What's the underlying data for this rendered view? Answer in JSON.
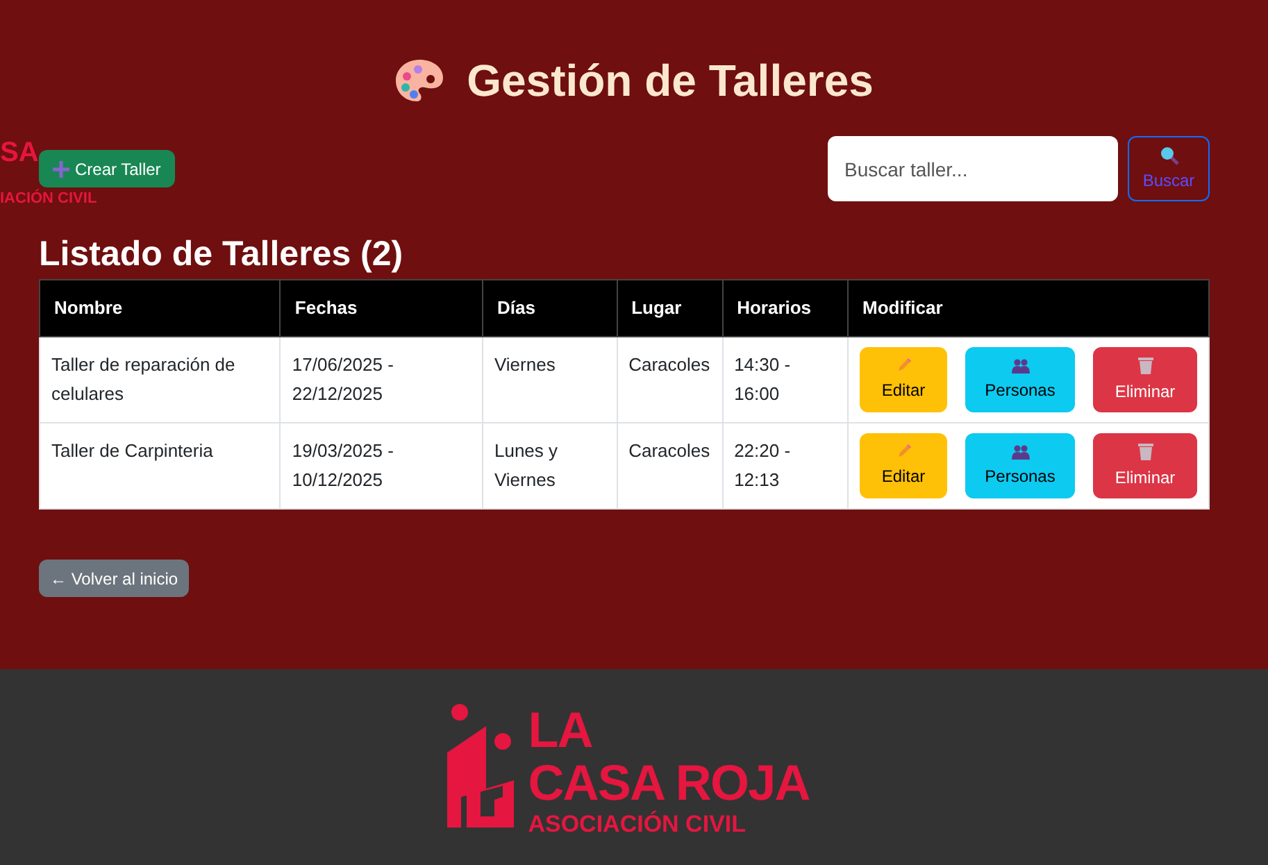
{
  "header": {
    "title": "Gestión de Talleres"
  },
  "side_logo": {
    "line_1": "SA",
    "line_2": "IACIÓN CIVIL"
  },
  "create_button": "Crear Taller",
  "search": {
    "placeholder": "Buscar taller...",
    "button": "Buscar"
  },
  "list_title": "Listado de Talleres (2)",
  "table": {
    "columns": [
      "Nombre",
      "Fechas",
      "Días",
      "Lugar",
      "Horarios",
      "Modificar"
    ],
    "rows": [
      {
        "cells": [
          "Taller de reparación de celulares",
          "17/06/2025 - 22/12/2025",
          "Viernes",
          "Caracoles",
          "14:30 - 16:00"
        ],
        "actions": [
          "Editar",
          "Personas",
          "Eliminar"
        ]
      },
      {
        "cells": [
          "Taller de Carpinteria",
          "19/03/2025 - 10/12/2025",
          "Lunes y Viernes",
          "Caracoles",
          "22:20 - 12:13"
        ],
        "actions": [
          "Editar",
          "Personas",
          "Eliminar"
        ]
      }
    ]
  },
  "back_button": "← Volver al inicio",
  "footer_logo": {
    "line_1": "LA",
    "line_2": "CASA ROJA",
    "line_3": "ASOCIACIÓN CIVIL"
  }
}
